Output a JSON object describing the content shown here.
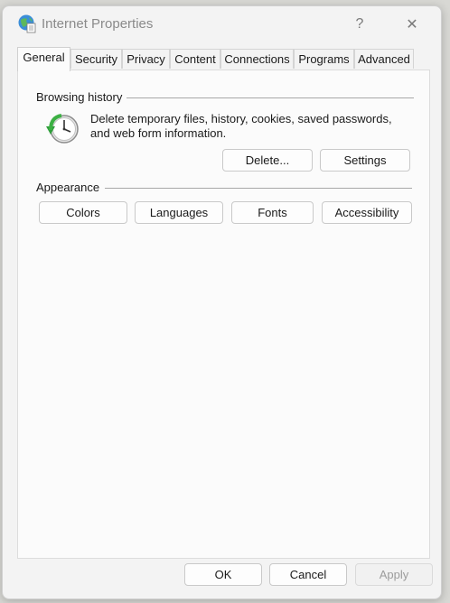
{
  "window": {
    "title": "Internet Properties",
    "help_glyph": "?",
    "close_glyph": "✕"
  },
  "tabs": [
    {
      "label": "General",
      "active": true
    },
    {
      "label": "Security"
    },
    {
      "label": "Privacy"
    },
    {
      "label": "Content"
    },
    {
      "label": "Connections"
    },
    {
      "label": "Programs"
    },
    {
      "label": "Advanced"
    }
  ],
  "browsing_history": {
    "label": "Browsing history",
    "description_line1": "Delete temporary files, history, cookies, saved passwords,",
    "description_line2": "and web form information.",
    "delete_label": "Delete...",
    "settings_label": "Settings"
  },
  "appearance": {
    "label": "Appearance",
    "buttons": [
      "Colors",
      "Languages",
      "Fonts",
      "Accessibility"
    ]
  },
  "footer": {
    "ok_label": "OK",
    "cancel_label": "Cancel",
    "apply_label": "Apply"
  }
}
